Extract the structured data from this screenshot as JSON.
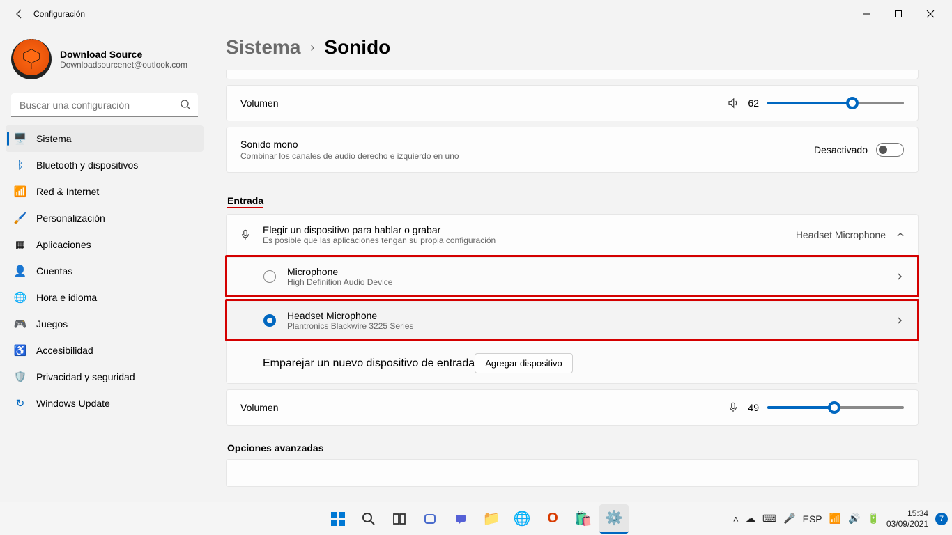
{
  "titlebar": {
    "title": "Configuración"
  },
  "profile": {
    "name": "Download Source",
    "email": "Downloadsourcenet@outlook.com"
  },
  "search": {
    "placeholder": "Buscar una configuración"
  },
  "nav": [
    {
      "label": "Sistema",
      "iconColor": "#0067c0"
    },
    {
      "label": "Bluetooth y dispositivos",
      "iconColor": "#0067c0"
    },
    {
      "label": "Red & Internet",
      "iconColor": "#0067c0"
    },
    {
      "label": "Personalización",
      "iconColor": "#7a5c3e"
    },
    {
      "label": "Aplicaciones",
      "iconColor": "#555"
    },
    {
      "label": "Cuentas",
      "iconColor": "#5aa0d8"
    },
    {
      "label": "Hora e idioma",
      "iconColor": "#4da0b8"
    },
    {
      "label": "Juegos",
      "iconColor": "#777"
    },
    {
      "label": "Accesibilidad",
      "iconColor": "#3ea0d0"
    },
    {
      "label": "Privacidad y seguridad",
      "iconColor": "#888"
    },
    {
      "label": "Windows Update",
      "iconColor": "#0067c0"
    }
  ],
  "breadcrumb": {
    "parent": "Sistema",
    "current": "Sonido"
  },
  "output": {
    "volume_label": "Volumen",
    "volume_value": 62,
    "mono_title": "Sonido mono",
    "mono_sub": "Combinar los canales de audio derecho e izquierdo en uno",
    "mono_state": "Desactivado"
  },
  "input": {
    "section": "Entrada",
    "chooser_title": "Elegir un dispositivo para hablar o grabar",
    "chooser_sub": "Es posible que las aplicaciones tengan su propia configuración",
    "chooser_current": "Headset Microphone",
    "devices": [
      {
        "name": "Microphone",
        "sub": "High Definition Audio Device",
        "selected": false
      },
      {
        "name": "Headset Microphone",
        "sub": "Plantronics Blackwire 3225 Series",
        "selected": true
      }
    ],
    "pair_label": "Emparejar un nuevo dispositivo de entrada",
    "pair_button": "Agregar dispositivo",
    "volume_label": "Volumen",
    "volume_value": 49
  },
  "advanced": {
    "heading": "Opciones avanzadas"
  },
  "tray": {
    "lang": "ESP",
    "time": "15:34",
    "date": "03/09/2021",
    "badge": "7"
  }
}
